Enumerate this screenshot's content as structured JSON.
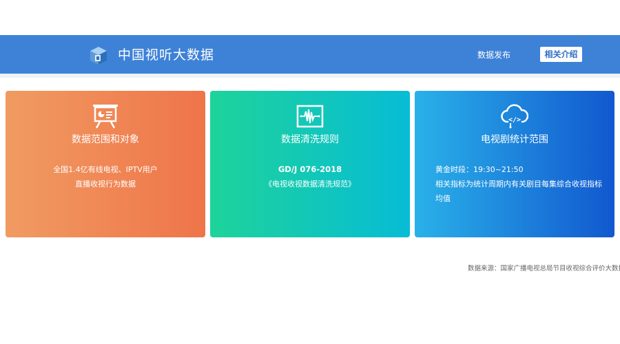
{
  "header": {
    "title": "中国视听大数据",
    "nav_link": "数据发布",
    "nav_button": "相关介绍",
    "logo_icon": "cube-logo-icon"
  },
  "cards": [
    {
      "title": "数据范围和对象",
      "icon": "presentation-board-icon",
      "lines": [
        "全国1.4亿有线电视、IPTV用户",
        "直播收视行为数据"
      ],
      "gradient": [
        "#f09b62",
        "#ef7449"
      ]
    },
    {
      "title": "数据清洗规则",
      "icon": "waveform-icon",
      "lines": [
        "GD/J 076-2018",
        "《电视收视数据清洗规范》"
      ],
      "gradient": [
        "#1ed39a",
        "#07bcd5"
      ]
    },
    {
      "title": "电视剧统计范围",
      "icon": "cloud-code-icon",
      "lines": [
        "黄金时段：19:30~21:50",
        "相关指标为统计周期内有关剧目每集综合收视指标均值"
      ],
      "gradient": [
        "#2ab1e9",
        "#1158cf"
      ]
    }
  ],
  "footer": {
    "source": "数据来源：国家广播电视总局节目收视综合评价大数据系"
  },
  "colors": {
    "header_bg": "#3e82d8",
    "button_text": "#2f6fc4"
  }
}
